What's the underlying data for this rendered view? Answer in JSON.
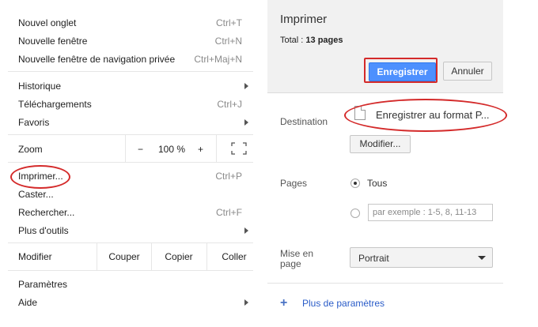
{
  "menu": {
    "group1": [
      {
        "label": "Nouvel onglet",
        "shortcut": "Ctrl+T"
      },
      {
        "label": "Nouvelle fenêtre",
        "shortcut": "Ctrl+N"
      },
      {
        "label": "Nouvelle fenêtre de navigation privée",
        "shortcut": "Ctrl+Maj+N"
      }
    ],
    "group2": [
      {
        "label": "Historique",
        "shortcut": ""
      },
      {
        "label": "Téléchargements",
        "shortcut": "Ctrl+J"
      },
      {
        "label": "Favoris",
        "shortcut": ""
      }
    ],
    "zoom": {
      "label": "Zoom",
      "minus": "−",
      "value": "100 %",
      "plus": "+"
    },
    "group3": [
      {
        "label": "Imprimer...",
        "shortcut": "Ctrl+P"
      },
      {
        "label": "Caster...",
        "shortcut": ""
      },
      {
        "label": "Rechercher...",
        "shortcut": "Ctrl+F"
      },
      {
        "label": "Plus d'outils",
        "shortcut": ""
      }
    ],
    "edit": {
      "label": "Modifier",
      "cut": "Couper",
      "copy": "Copier",
      "paste": "Coller"
    },
    "group4": [
      {
        "label": "Paramètres",
        "shortcut": ""
      },
      {
        "label": "Aide",
        "shortcut": ""
      }
    ]
  },
  "print": {
    "title": "Imprimer",
    "total_prefix": "Total : ",
    "total_value": "13 pages",
    "save_label": "Enregistrer",
    "cancel_label": "Annuler",
    "destination_label": "Destination",
    "destination_value": "Enregistrer au format P...",
    "modify_label": "Modifier...",
    "pages_label": "Pages",
    "pages_all": "Tous",
    "pages_placeholder": "par exemple : 1-5, 8, 11-13",
    "layout_label_line1": "Mise en",
    "layout_label_line2": "page",
    "layout_value": "Portrait",
    "more_settings": "Plus de paramètres"
  },
  "colors": {
    "accent_blue": "#4d90fe",
    "highlight_red": "#d42a2a",
    "link_blue": "#2a5cc8"
  }
}
